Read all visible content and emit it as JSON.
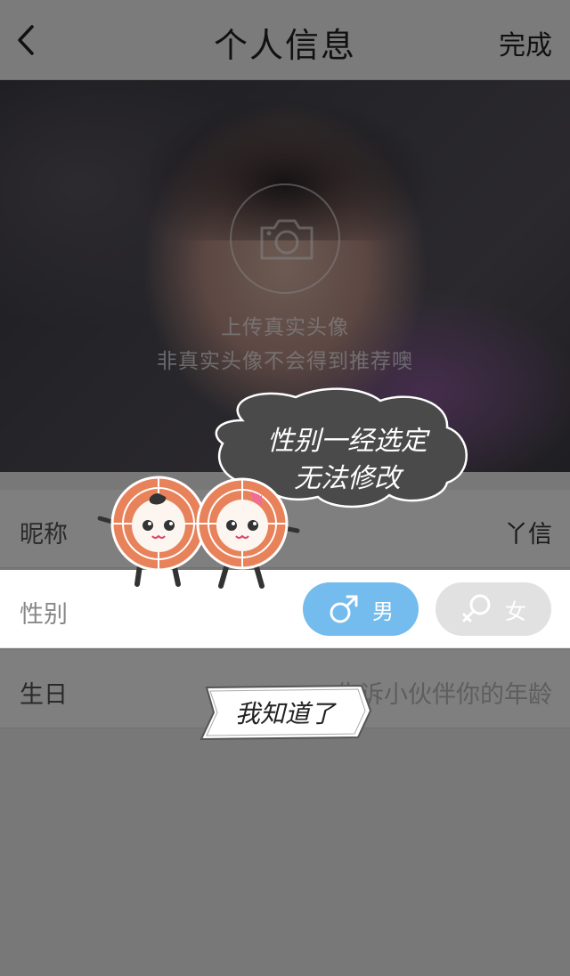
{
  "header": {
    "back_icon": "chevron-left-icon",
    "title": "个人信息",
    "done_label": "完成"
  },
  "avatar_upload": {
    "icon": "camera-icon",
    "title": "上传真实头像",
    "subtitle": "非真实头像不会得到推荐噢"
  },
  "form": {
    "nickname": {
      "label": "昵称",
      "value": "丫信"
    },
    "gender": {
      "label": "性别",
      "male_label": "男",
      "female_label": "女",
      "male_icon": "male-symbol-icon",
      "female_icon": "female-symbol-icon",
      "selected": "男",
      "male_color": "#74bbee",
      "female_color": "#e1e1e1"
    },
    "birthday": {
      "label": "生日",
      "placeholder": "告诉小伙伴你的年龄"
    }
  },
  "coach_mark": {
    "bubble_line1": "性别一经选定",
    "bubble_line2": "无法修改",
    "ack_label": "我知道了"
  }
}
